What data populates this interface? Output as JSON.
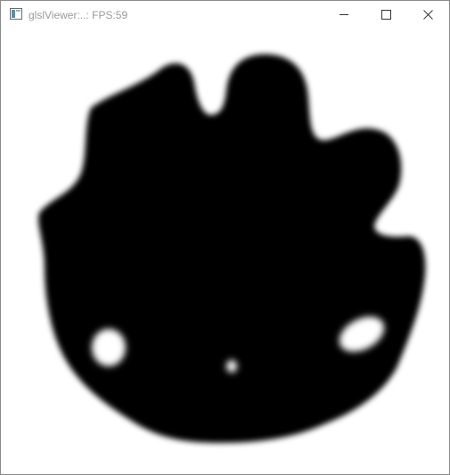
{
  "window": {
    "title": "glslViewer:..: FPS:59"
  },
  "titlebar": {
    "icons": {
      "app": "window-app-icon",
      "minimize": "minimize-icon",
      "maximize": "maximize-icon",
      "close": "close-icon"
    }
  },
  "viewport": {
    "content": "render-output-blob",
    "colors": {
      "background": "#ffffff",
      "shape": "#000000"
    }
  }
}
